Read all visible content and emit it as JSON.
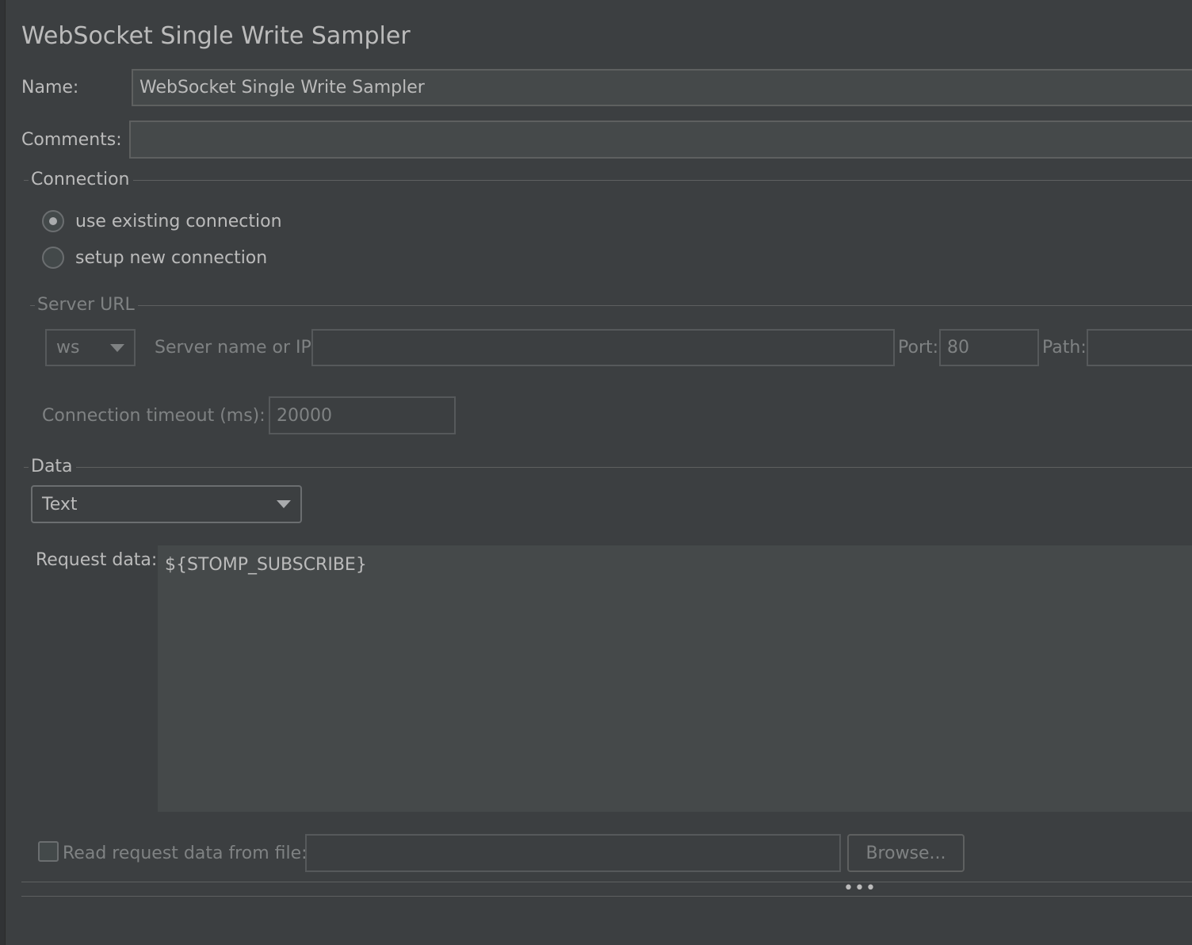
{
  "title": "WebSocket Single Write Sampler",
  "name": {
    "label": "Name:",
    "value": "WebSocket Single Write Sampler"
  },
  "comments": {
    "label": "Comments:",
    "value": ""
  },
  "connection": {
    "group_title": "Connection",
    "options": [
      {
        "label": "use existing connection",
        "selected": true
      },
      {
        "label": "setup new connection",
        "selected": false
      }
    ]
  },
  "server_url": {
    "group_title": "Server URL",
    "protocol": "ws",
    "server_label": "Server name or IP:",
    "server_value": "",
    "port_label": "Port:",
    "port_value": "80",
    "path_label": "Path:",
    "path_value": "",
    "timeout_label": "Connection timeout (ms):",
    "timeout_value": "20000"
  },
  "data": {
    "group_title": "Data",
    "type": "Text",
    "request_label": "Request data:",
    "request_value": "${STOMP_SUBSCRIBE}",
    "file_checkbox_label": "Read request data from file:",
    "file_value": "",
    "browse_label": "Browse..."
  },
  "splitter": "•••"
}
